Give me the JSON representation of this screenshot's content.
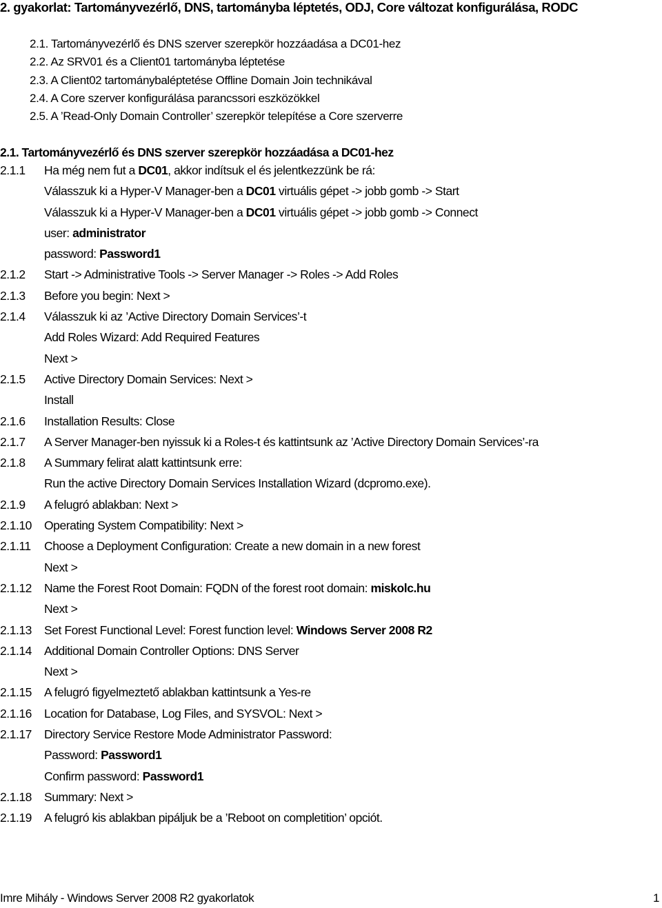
{
  "document": {
    "title": "2. gyakorlat: Tartományvezérlő, DNS, tartományba léptetés, ODJ, Core változat konfigurálása, RODC",
    "toc": [
      {
        "number": "2.1.",
        "label": "Tartományvezérlő és DNS szerver szerepkör hozzáadása a DC01-hez"
      },
      {
        "number": "2.2.",
        "label": "Az SRV01 és a Client01 tartományba léptetése"
      },
      {
        "number": "2.3.",
        "label": "A Client02 tartománybaléptetése Offline Domain Join technikával"
      },
      {
        "number": "2.4.",
        "label": "A Core szerver konfigurálása parancssori eszközökkel"
      },
      {
        "number": "2.5.",
        "label": "A ’Read-Only Domain Controller’ szerepkör telepítése a Core szerverre"
      }
    ],
    "section": {
      "heading": "2.1. Tartományvezérlő és DNS szerver szerepkör hozzáadása a DC01-hez",
      "steps": [
        {
          "number": "2.1.1",
          "lines": [
            [
              {
                "t": "Ha még nem fut a "
              },
              {
                "t": "DC01",
                "b": true
              },
              {
                "t": ", akkor indítsuk el és jelentkezzünk be rá:"
              }
            ],
            [
              {
                "t": "Válasszuk ki a Hyper-V Manager-ben a "
              },
              {
                "t": "DC01",
                "b": true
              },
              {
                "t": " virtuális gépet -> jobb gomb -> Start"
              }
            ],
            [
              {
                "t": "Válasszuk ki a Hyper-V Manager-ben a "
              },
              {
                "t": "DC01",
                "b": true
              },
              {
                "t": " virtuális gépet -> jobb gomb -> Connect"
              }
            ],
            [
              {
                "t": "user: "
              },
              {
                "t": "administrator",
                "b": true
              }
            ],
            [
              {
                "t": "password: "
              },
              {
                "t": "Password1",
                "b": true
              }
            ]
          ]
        },
        {
          "number": "2.1.2",
          "lines": [
            [
              {
                "t": "Start -> Administrative Tools -> Server Manager -> Roles -> Add Roles"
              }
            ]
          ]
        },
        {
          "number": "2.1.3",
          "lines": [
            [
              {
                "t": "Before you begin: Next >"
              }
            ]
          ]
        },
        {
          "number": "2.1.4",
          "lines": [
            [
              {
                "t": "Válasszuk ki az ’Active Directory Domain Services’-t"
              }
            ],
            [
              {
                "t": "Add Roles Wizard: Add Required Features"
              }
            ],
            [
              {
                "t": "Next >"
              }
            ]
          ]
        },
        {
          "number": "2.1.5",
          "lines": [
            [
              {
                "t": "Active Directory Domain Services: Next >"
              }
            ],
            [
              {
                "t": "Install"
              }
            ]
          ]
        },
        {
          "number": "2.1.6",
          "lines": [
            [
              {
                "t": "Installation Results: Close"
              }
            ]
          ]
        },
        {
          "number": "2.1.7",
          "lines": [
            [
              {
                "t": "A Server Manager-ben nyissuk ki a Roles-t és kattintsunk az ’Active Directory Domain Services’-ra"
              }
            ]
          ]
        },
        {
          "number": "2.1.8",
          "lines": [
            [
              {
                "t": "A Summary felirat alatt kattintsunk erre:"
              }
            ],
            [
              {
                "t": "Run the active Directory Domain Services Installation Wizard (dcpromo.exe)."
              }
            ]
          ]
        },
        {
          "number": "2.1.9",
          "lines": [
            [
              {
                "t": "A felugró ablakban: Next >"
              }
            ]
          ]
        },
        {
          "number": "2.1.10",
          "lines": [
            [
              {
                "t": "Operating System Compatibility: Next >"
              }
            ]
          ]
        },
        {
          "number": "2.1.11",
          "lines": [
            [
              {
                "t": "Choose a Deployment Configuration: Create a new domain in a new forest"
              }
            ],
            [
              {
                "t": "Next >"
              }
            ]
          ]
        },
        {
          "number": "2.1.12",
          "lines": [
            [
              {
                "t": "Name the Forest Root Domain: FQDN of the forest root domain: "
              },
              {
                "t": "miskolc.hu",
                "b": true
              }
            ],
            [
              {
                "t": "Next >"
              }
            ]
          ]
        },
        {
          "number": "2.1.13",
          "lines": [
            [
              {
                "t": "Set Forest Functional Level: Forest function level: "
              },
              {
                "t": "Windows Server 2008 R2",
                "b": true
              }
            ]
          ]
        },
        {
          "number": "2.1.14",
          "lines": [
            [
              {
                "t": "Additional Domain Controller Options: DNS Server"
              }
            ],
            [
              {
                "t": "Next >"
              }
            ]
          ]
        },
        {
          "number": "2.1.15",
          "lines": [
            [
              {
                "t": "A felugró figyelmeztető ablakban kattintsunk a Yes-re"
              }
            ]
          ]
        },
        {
          "number": "2.1.16",
          "lines": [
            [
              {
                "t": "Location for Database, Log Files, and SYSVOL: Next >"
              }
            ]
          ]
        },
        {
          "number": "2.1.17",
          "lines": [
            [
              {
                "t": "Directory Service Restore Mode Administrator Password:"
              }
            ],
            [
              {
                "t": "Password: "
              },
              {
                "t": "Password1",
                "b": true
              }
            ],
            [
              {
                "t": "Confirm password: "
              },
              {
                "t": "Password1",
                "b": true
              }
            ]
          ]
        },
        {
          "number": "2.1.18",
          "lines": [
            [
              {
                "t": "Summary: Next >"
              }
            ]
          ]
        },
        {
          "number": "2.1.19",
          "lines": [
            [
              {
                "t": "A felugró kis ablakban pipáljuk be a ’Reboot on completition’ opciót."
              }
            ]
          ]
        }
      ]
    },
    "footer": {
      "left": "Imre Mihály - Windows Server 2008 R2 gyakorlatok",
      "page_number": "1"
    }
  }
}
